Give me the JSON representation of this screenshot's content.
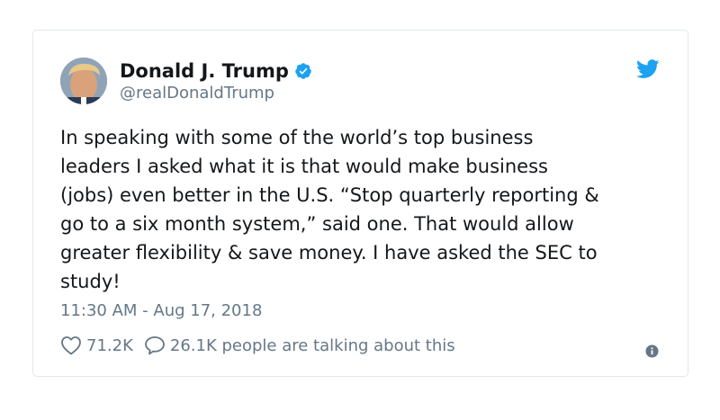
{
  "tweet": {
    "author": {
      "name": "Donald J. Trump",
      "handle": "@realDonaldTrump",
      "verified": true
    },
    "text": "In speaking with some of the world’s top business\nleaders I asked what it is that would make business\n(jobs) even better in the U.S. “Stop quarterly reporting &\ngo to a six month system,” said one. That would allow\ngreater flexibility & save money. I have asked the SEC to\nstudy!",
    "timestamp": "11:30 AM - Aug 17, 2018",
    "likes": "71.2K",
    "comments": "26.1K people are talking about this"
  },
  "icons": {
    "brand": "twitter-bird-icon",
    "verified": "verified-badge-icon",
    "like": "heart-icon",
    "comment": "speech-bubble-icon",
    "info": "info-icon"
  },
  "colors": {
    "brand_blue": "#1da1f2",
    "text": "#14171a",
    "muted": "#657786",
    "border": "#e1e8ed"
  }
}
